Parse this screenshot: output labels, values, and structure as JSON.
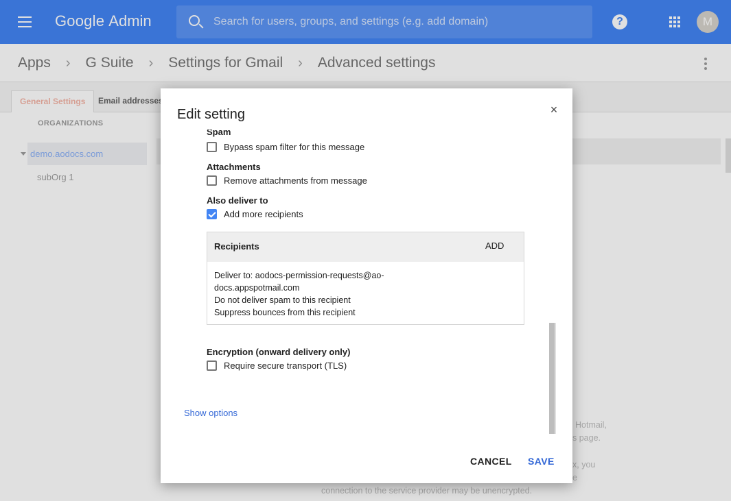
{
  "topbar": {
    "logo_google": "Google",
    "logo_admin": "Admin",
    "search_placeholder": "Search for users, groups, and settings (e.g. add domain)",
    "avatar_initial": "M",
    "help_glyph": "?"
  },
  "breadcrumb": [
    "Apps",
    "G Suite",
    "Settings for Gmail",
    "Advanced settings"
  ],
  "tabs": [
    "General Settings",
    "Email addresses"
  ],
  "orgs": {
    "header": "ORGANIZATIONS",
    "items": [
      "demo.aodocs.com",
      "subOrg 1"
    ]
  },
  "background_text": [
    "Hotmail,",
    "s page.",
    "x, you",
    "e",
    "connection to the service provider may be unencrypted."
  ],
  "dialog": {
    "title": "Edit setting",
    "close_glyph": "×",
    "cut_label": "Spam",
    "sections": [
      {
        "checkbox_label": "Bypass spam filter for this message",
        "checked": false
      },
      {
        "label": "Attachments",
        "checkbox_label": "Remove attachments from message",
        "checked": false
      },
      {
        "label": "Also deliver to",
        "checkbox_label": "Add more recipients",
        "checked": true
      },
      {
        "label": "Encryption (onward delivery only)",
        "checkbox_label": "Require secure transport (TLS)",
        "checked": false
      }
    ],
    "recipients": {
      "title": "Recipients",
      "add_label": "ADD",
      "lines": [
        "Deliver to: aodocs-permission-requests@ao-",
        "docs.appspotmail.com",
        "Do not deliver spam to this recipient",
        "Suppress bounces from this recipient"
      ]
    },
    "show_options": "Show options",
    "cancel_label": "CANCEL",
    "save_label": "SAVE"
  },
  "colors": {
    "topbar": "#4285f4",
    "primary_action": "#3367d6",
    "checkbox_checked": "#4285f4"
  }
}
